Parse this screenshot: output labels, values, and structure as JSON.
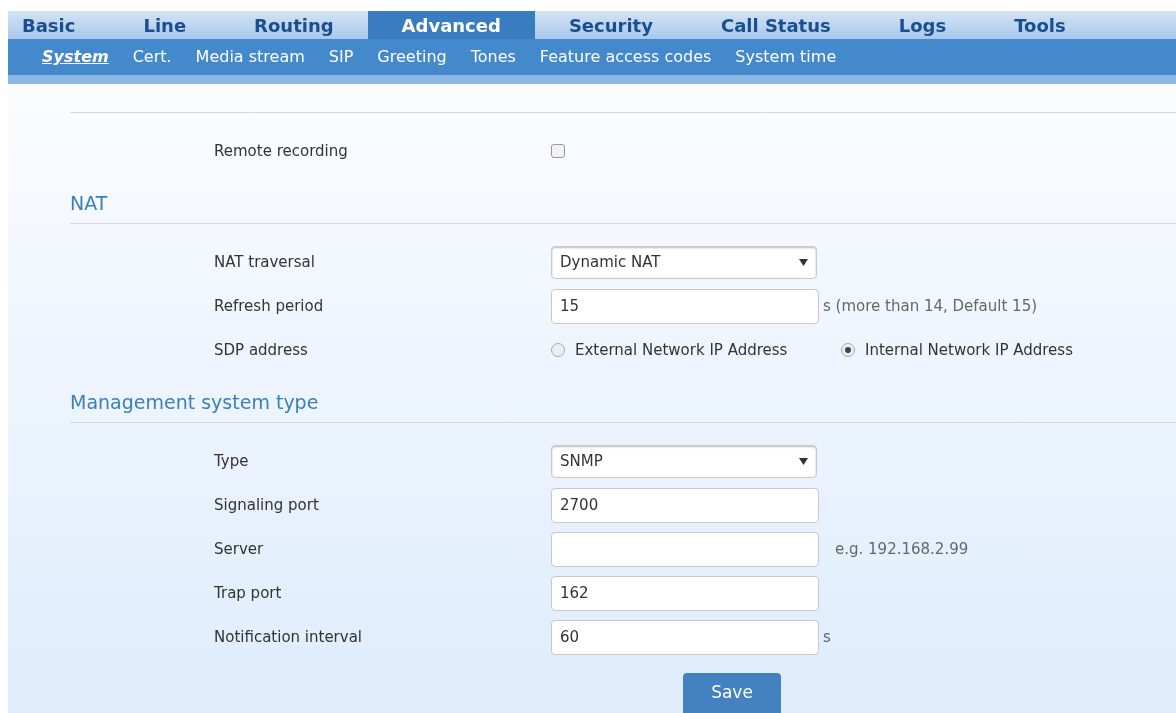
{
  "tabs": [
    {
      "label": "Basic",
      "selected": false
    },
    {
      "label": "Line",
      "selected": false
    },
    {
      "label": "Routing",
      "selected": false
    },
    {
      "label": "Advanced",
      "selected": true
    },
    {
      "label": "Security",
      "selected": false
    },
    {
      "label": "Call Status",
      "selected": false
    },
    {
      "label": "Logs",
      "selected": false
    },
    {
      "label": "Tools",
      "selected": false
    }
  ],
  "subtabs": [
    {
      "label": "System",
      "selected": true
    },
    {
      "label": "Cert.",
      "selected": false
    },
    {
      "label": "Media stream",
      "selected": false
    },
    {
      "label": "SIP",
      "selected": false
    },
    {
      "label": "Greeting",
      "selected": false
    },
    {
      "label": "Tones",
      "selected": false
    },
    {
      "label": "Feature access codes",
      "selected": false
    },
    {
      "label": "System time",
      "selected": false
    }
  ],
  "sections": [
    {
      "fields": [
        {
          "kind": "checkbox",
          "label": "Remote recording",
          "checked": false
        }
      ]
    },
    {
      "title": "NAT",
      "fields": [
        {
          "kind": "select",
          "label": "NAT traversal",
          "value": "Dynamic NAT"
        },
        {
          "kind": "text",
          "label": "Refresh period",
          "value": "15",
          "hint": "s (more than 14, Default 15)"
        },
        {
          "kind": "radio",
          "label": "SDP address",
          "options": [
            {
              "label": "External Network IP Address",
              "selected": false
            },
            {
              "label": "Internal Network IP Address",
              "selected": true
            }
          ]
        }
      ]
    },
    {
      "title": "Management system type",
      "fields": [
        {
          "kind": "select",
          "label": "Type",
          "value": "SNMP"
        },
        {
          "kind": "text",
          "label": "Signaling port",
          "value": "2700"
        },
        {
          "kind": "text",
          "label": "Server",
          "hint": "e.g. 192.168.2.99"
        },
        {
          "kind": "text",
          "label": "Trap port",
          "value": "162"
        },
        {
          "kind": "text",
          "label": "Notification interval",
          "value": "60",
          "hint": "s"
        }
      ]
    }
  ],
  "save_button": "Save"
}
